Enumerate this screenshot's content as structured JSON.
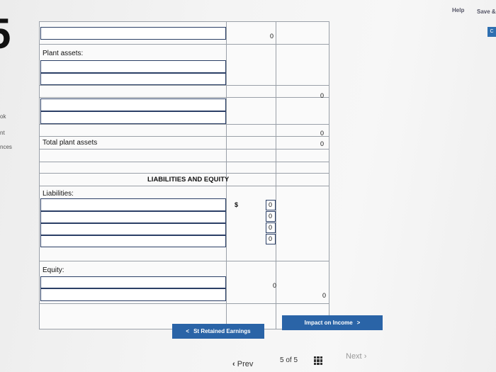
{
  "header": {
    "help": "Help",
    "save": "Save &"
  },
  "left": {
    "section_number": "5",
    "items": [
      "ok",
      "nt",
      "nces"
    ],
    "square_button": "C"
  },
  "form": {
    "top_value": "0",
    "plant_assets_label": "Plant assets:",
    "plant_value_1": "0",
    "plant_value_2": "0",
    "plant_value_3": "0",
    "total_plant_assets_label": "Total plant assets",
    "heading": "LIABILITIES AND EQUITY",
    "liabilities_label": "Liabilities:",
    "dollar_sign": "$",
    "liab_values": [
      "0",
      "0",
      "0",
      "0"
    ],
    "equity_label": "Equity:",
    "equity_value": "0",
    "total_value": "0"
  },
  "buttons": {
    "retained_earnings": "St Retained Earnings",
    "impact_on_income": "Impact on Income",
    "prev_arrow": "<",
    "next_arrow": ">"
  },
  "pagination": {
    "prev": "Prev",
    "current": "5",
    "of": "of",
    "total": "5",
    "next": "Next"
  }
}
